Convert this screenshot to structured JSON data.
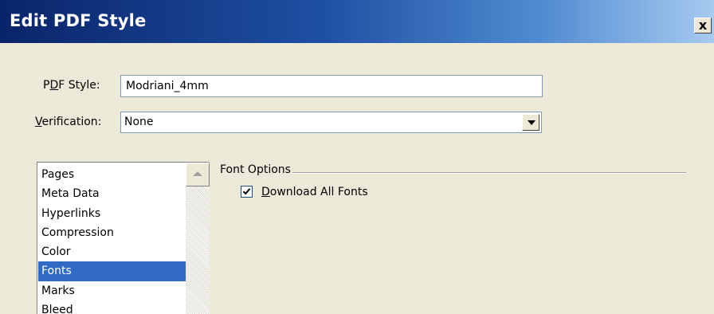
{
  "window": {
    "title": "Edit PDF Style",
    "close_label": "x"
  },
  "form": {
    "pdf_style_label": {
      "mnemonic": "D",
      "before": "P",
      "after": "F Style:"
    },
    "pdf_style_value": "Modriani_4mm",
    "verification_label": {
      "mnemonic": "V",
      "after": "erification:"
    },
    "verification_value": "None"
  },
  "sidebar": {
    "items": [
      {
        "label": "Pages"
      },
      {
        "label": "Meta Data"
      },
      {
        "label": "Hyperlinks"
      },
      {
        "label": "Compression"
      },
      {
        "label": "Color"
      },
      {
        "label": "Fonts",
        "selected": true
      },
      {
        "label": "Marks"
      },
      {
        "label": "Bleed"
      }
    ]
  },
  "font_options": {
    "group_title": "Font Options",
    "download_all_fonts": {
      "checked": true,
      "mnemonic": "D",
      "label_rest": "ownload All Fonts"
    }
  },
  "colors": {
    "selection": "#316ac5",
    "dialog_bg": "#ece9d8"
  },
  "icons": {
    "close": "close-icon",
    "dropdown": "chevron-down-icon",
    "scroll_up": "scroll-up-arrow-icon",
    "check": "checkmark-icon"
  }
}
